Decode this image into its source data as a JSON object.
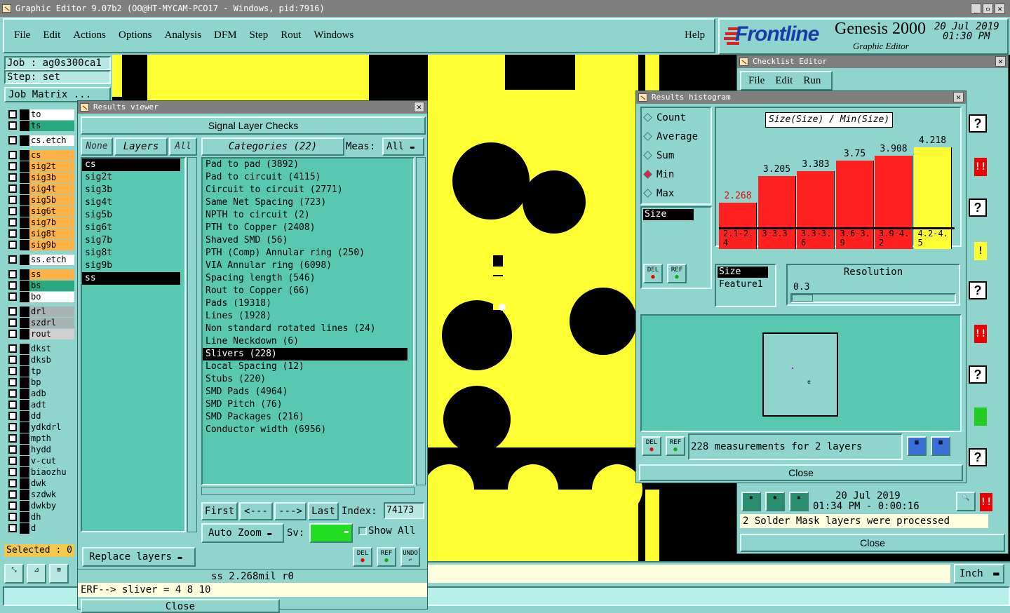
{
  "app": {
    "window_title": "Graphic Editor 9.07b2 (OO@HT-MYCAM-PCO17 - Windows, pid:7916)",
    "menu": [
      "File",
      "Edit",
      "Actions",
      "Options",
      "Analysis",
      "DFM",
      "Step",
      "Rout",
      "Windows"
    ],
    "help": "Help",
    "brand": "Frontline",
    "product": "Genesis 2000",
    "subtitle": "Graphic Editor",
    "date": "20 Jul 2019",
    "time": "01:30 PM"
  },
  "job": {
    "job_label": "Job : ag0s300ca1",
    "step_label": "Step: set",
    "matrix_button": "Job Matrix ..."
  },
  "layers": [
    {
      "name": "to",
      "color": "#ffffff"
    },
    {
      "name": "ts",
      "color": "#2aa87f"
    },
    {
      "name": "cs.etch",
      "color": "#ffffff"
    },
    {
      "name": "cs",
      "color": "#ffb347"
    },
    {
      "name": "sig2t",
      "color": "#ffb347"
    },
    {
      "name": "sig3b",
      "color": "#ffb347"
    },
    {
      "name": "sig4t",
      "color": "#ffb347"
    },
    {
      "name": "sig5b",
      "color": "#ffb347"
    },
    {
      "name": "sig6t",
      "color": "#ffb347"
    },
    {
      "name": "sig7b",
      "color": "#ffb347"
    },
    {
      "name": "sig8t",
      "color": "#ffb347"
    },
    {
      "name": "sig9b",
      "color": "#ffb347"
    },
    {
      "name": "ss.etch",
      "color": "#ffffff"
    },
    {
      "name": "ss",
      "color": "#ffb347"
    },
    {
      "name": "bs",
      "color": "#2aa87f"
    },
    {
      "name": "bo",
      "color": "#ffffff"
    },
    {
      "name": "drl",
      "color": "#a8b4b4"
    },
    {
      "name": "szdrl",
      "color": "#a8b4b4"
    },
    {
      "name": "rout",
      "color": "#d0d0d0"
    },
    {
      "name": "dkst",
      "color": "#8fd4cd"
    },
    {
      "name": "dksb",
      "color": "#8fd4cd"
    },
    {
      "name": "tp",
      "color": "#8fd4cd"
    },
    {
      "name": "bp",
      "color": "#8fd4cd"
    },
    {
      "name": "adb",
      "color": "#8fd4cd"
    },
    {
      "name": "adt",
      "color": "#8fd4cd"
    },
    {
      "name": "dd",
      "color": "#8fd4cd"
    },
    {
      "name": "ydkdrl",
      "color": "#8fd4cd"
    },
    {
      "name": "mpth",
      "color": "#8fd4cd"
    },
    {
      "name": "hydd",
      "color": "#8fd4cd"
    },
    {
      "name": "v-cut",
      "color": "#8fd4cd"
    },
    {
      "name": "biaozhu",
      "color": "#8fd4cd"
    },
    {
      "name": "dwk",
      "color": "#8fd4cd"
    },
    {
      "name": "szdwk",
      "color": "#8fd4cd"
    },
    {
      "name": "dwkby",
      "color": "#8fd4cd"
    },
    {
      "name": "dh",
      "color": "#8fd4cd"
    },
    {
      "name": "d",
      "color": "#8fd4cd"
    }
  ],
  "selected": "Selected : 0",
  "results_viewer": {
    "title": "Results viewer",
    "header": "Signal Layer Checks",
    "none": "None",
    "layers_btn": "Layers",
    "all": "All",
    "categories_btn": "Categories (22)",
    "meas_label": "Meas:",
    "meas_value": "All",
    "layer_list": [
      "cs",
      "sig2t",
      "sig3b",
      "sig4t",
      "sig5b",
      "sig6t",
      "sig7b",
      "sig8t",
      "sig9b",
      "ss"
    ],
    "categories": [
      "Pad to pad (3892)",
      "Pad to circuit (4115)",
      "Circuit to circuit (2771)",
      "Same Net Spacing (723)",
      "NPTH to circuit (2)",
      "PTH to Copper (2408)",
      "Shaved SMD (56)",
      "PTH (Comp) Annular ring (250)",
      "VIA Annular ring (6098)",
      "Spacing length (546)",
      "Rout to Copper (66)",
      "Pads (19318)",
      "Lines (1928)",
      "Non standard rotated lines (24)",
      "Line Neckdown (6)",
      "Slivers (228)",
      "Local Spacing (12)",
      "Stubs (220)",
      "SMD Pads (4964)",
      "SMD Pitch (76)",
      "SMD Packages (216)",
      "Conductor width (6956)"
    ],
    "nav": {
      "first": "First",
      "prev": "<---",
      "next": "--->",
      "last": "Last",
      "index_label": "Index:",
      "index_value": "74173"
    },
    "auto_zoom": "Auto Zoom",
    "sv_label": "Sv:",
    "show_all": "Show All",
    "replace_layers": "Replace layers",
    "del": "DEL",
    "ref": "REF",
    "undo": "UNDO",
    "status": "ss 2.268mil  r0",
    "erf": "ERF--> sliver = 4 8 10",
    "close": "Close"
  },
  "checklist": {
    "title": "Checklist Editor",
    "menu": [
      "File",
      "Edit",
      "Run"
    ],
    "date": "20 Jul 2019",
    "elapsed": "01:34 PM - 0:00:16",
    "message": "2 Solder Mask layers were processed",
    "close": "Close"
  },
  "histogram": {
    "title": "Results histogram",
    "options": [
      "Count",
      "Average",
      "Sum",
      "Min",
      "Max"
    ],
    "selected_option": "Min",
    "axis_title": "Size(Size) / Min(Size)",
    "list_item": "Size",
    "chart_data": {
      "type": "bar",
      "title": "Size(Size) / Min(Size)",
      "categories": [
        "2.1-2.4",
        "3-3.3",
        "3.3-3.6",
        "3.6-3.9",
        "3.9-4.2",
        "4.2-4.5"
      ],
      "values": [
        2.268,
        3.205,
        3.383,
        3.75,
        3.908,
        4.218
      ],
      "colors": [
        "#ff2020",
        "#ff2020",
        "#ff2020",
        "#ff2020",
        "#ff2020",
        "#ffff33"
      ]
    },
    "field_list": [
      "Size",
      "Feature1"
    ],
    "resolution_label": "Resolution",
    "resolution_value": "0.3",
    "measurements": "228 measurements for 2 layers",
    "close": "Close"
  },
  "units": "Inch"
}
